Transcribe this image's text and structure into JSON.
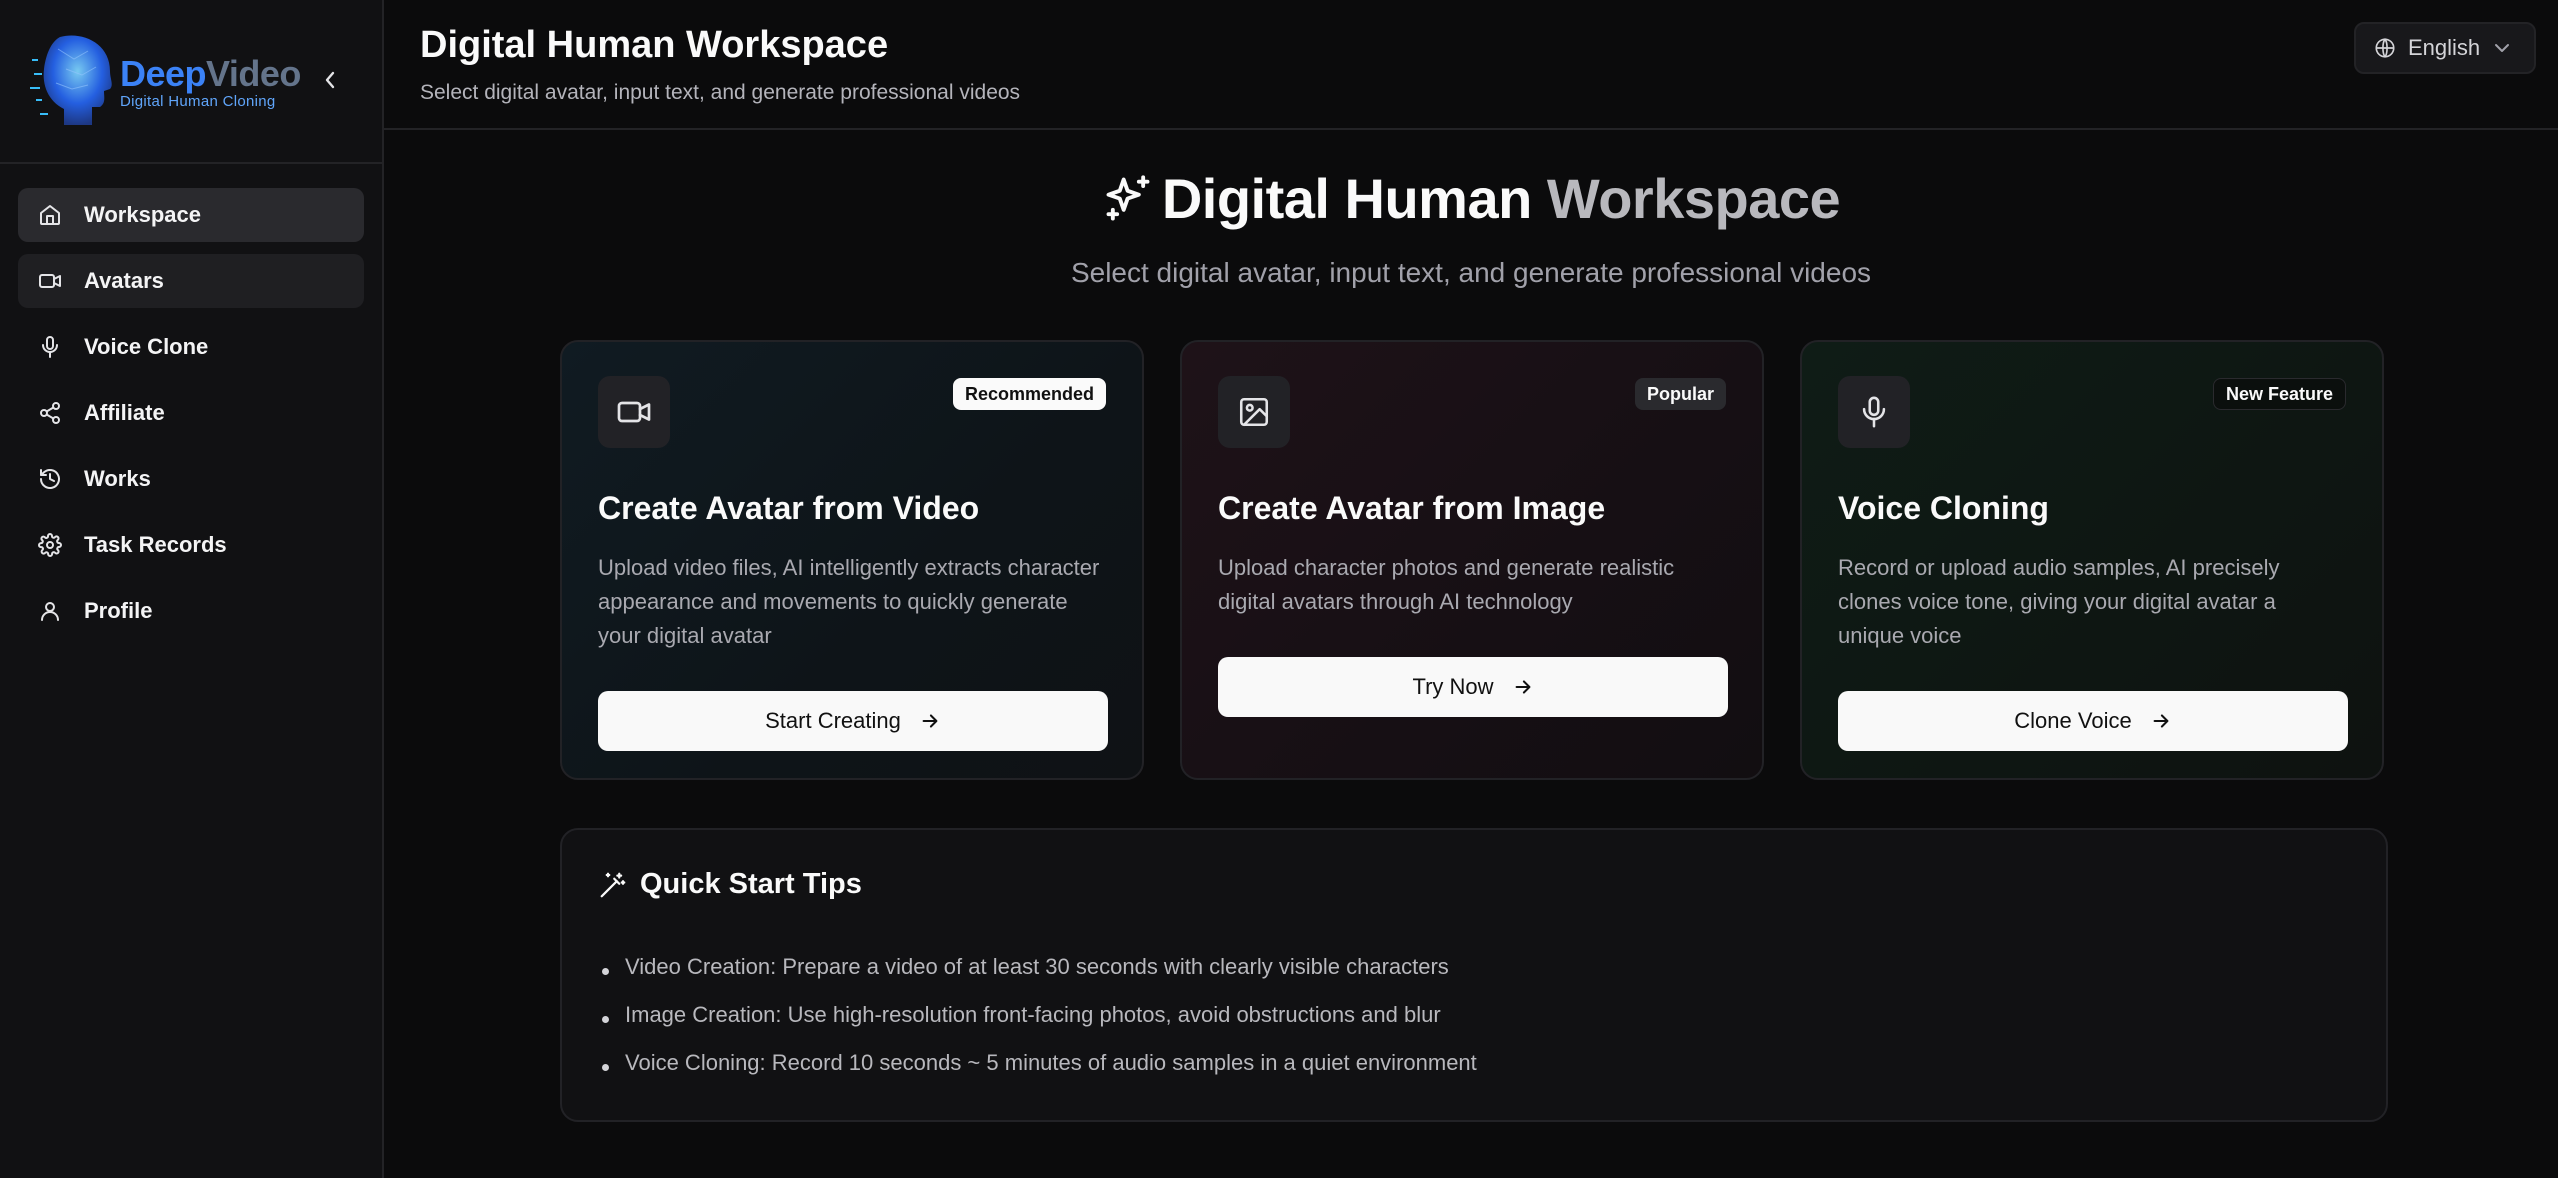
{
  "brand": {
    "name_main": "Deep",
    "name_accent": "Video",
    "tagline": "Digital Human Cloning"
  },
  "sidebar": {
    "items": [
      {
        "label": "Workspace",
        "icon": "home-icon",
        "state": "active"
      },
      {
        "label": "Avatars",
        "icon": "video-camera-icon",
        "state": "hover"
      },
      {
        "label": "Voice Clone",
        "icon": "microphone-icon",
        "state": ""
      },
      {
        "label": "Affiliate",
        "icon": "share-icon",
        "state": ""
      },
      {
        "label": "Works",
        "icon": "history-icon",
        "state": ""
      },
      {
        "label": "Task Records",
        "icon": "gear-icon",
        "state": ""
      },
      {
        "label": "Profile",
        "icon": "user-icon",
        "state": ""
      }
    ]
  },
  "header": {
    "title": "Digital Human Workspace",
    "subtitle": "Select digital avatar, input text, and generate professional videos",
    "language": "English"
  },
  "hero": {
    "title_part1": "Digital Human",
    "title_part2": "Workspace",
    "subtitle": "Select digital avatar, input text, and generate professional videos"
  },
  "cards": [
    {
      "badge": "Recommended",
      "title": "Create Avatar from Video",
      "description": "Upload video files, AI intelligently extracts character appearance and movements to quickly generate your digital avatar",
      "button": "Start Creating",
      "icon": "video-camera-icon"
    },
    {
      "badge": "Popular",
      "title": "Create Avatar from Image",
      "description": "Upload character photos and generate realistic digital avatars through AI technology",
      "button": "Try Now",
      "icon": "image-icon"
    },
    {
      "badge": "New Feature",
      "title": "Voice Cloning",
      "description": "Record or upload audio samples, AI precisely clones voice tone, giving your digital avatar a unique voice",
      "button": "Clone Voice",
      "icon": "microphone-icon"
    }
  ],
  "tips": {
    "title": "Quick Start Tips",
    "items": [
      "Video Creation: Prepare a video of at least 30 seconds with clearly visible characters",
      "Image Creation: Use high-resolution front-facing photos, avoid obstructions and blur",
      "Voice Cloning: Record 10 seconds ~ 5 minutes of audio samples in a quiet environment"
    ]
  },
  "colors": {
    "background": "#0b0b0c",
    "sidebar": "#111113",
    "brand_blue": "#3b82f6",
    "button_bg": "#f9f9f9"
  }
}
